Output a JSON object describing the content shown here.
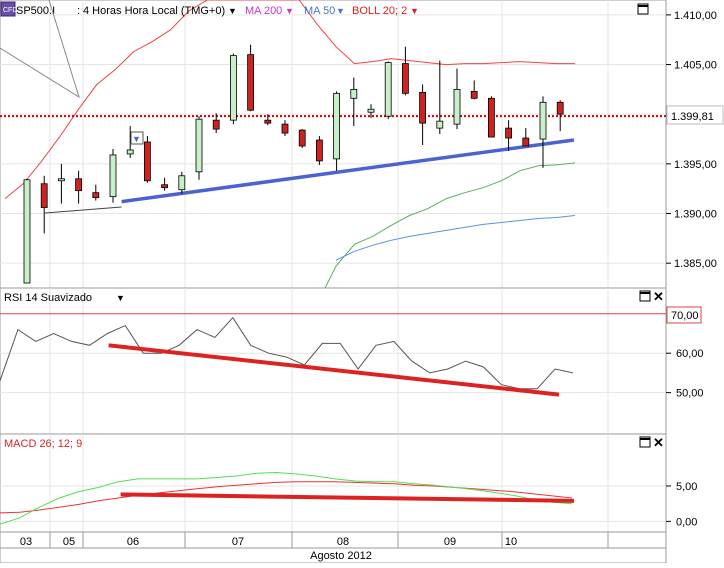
{
  "main_panel": {
    "symbol": "SP500.I",
    "timeframe": "4 Horas Hora Local (TMG+0)",
    "ma200_label": "MA 200",
    "ma50_label": "MA 50",
    "boll_label": "BOLL 20; 2",
    "last_price_label": "1.399,81",
    "y_ticks": [
      "1.410,00",
      "1.405,00",
      "1.400,00",
      "1.395,00",
      "1.390,00",
      "1.385,00"
    ]
  },
  "rsi_panel": {
    "title": "RSI 14 Suavizado",
    "level_label": "70,00",
    "y_ticks": [
      "60,00",
      "50,00"
    ]
  },
  "macd_panel": {
    "title": "MACD 26; 12; 9",
    "y_ticks": [
      "5,00",
      "0,00"
    ]
  },
  "x_axis": {
    "days": [
      "03",
      "05",
      "06",
      "07",
      "08",
      "09",
      "10"
    ],
    "month_label": "Agosto 2012"
  },
  "colors": {
    "bull": "#c8f0c8",
    "bear": "#cc2222",
    "boll": "#ee4444",
    "ma50": "#5b8fe8",
    "ma200": "#5cae5c",
    "trendline_blue": "#4a63d0",
    "trendline_red": "#dd2222",
    "rsi_line": "#555555",
    "macd_line": "#ee3333",
    "signal_line": "#55dd55"
  },
  "chart_data": [
    {
      "type": "candlestick",
      "title": "SP500.I 4 Horas Hora Local (TMG+0)",
      "ylim": [
        1382.5,
        1411.5
      ],
      "candles": [
        {
          "open": 1383.0,
          "high": 1393.5,
          "low": 1383.0,
          "close": 1393.4
        },
        {
          "open": 1393.0,
          "high": 1393.8,
          "low": 1388.0,
          "close": 1390.6
        },
        {
          "open": 1393.3,
          "high": 1395.0,
          "low": 1391.0,
          "close": 1393.5
        },
        {
          "open": 1393.5,
          "high": 1394.3,
          "low": 1391.0,
          "close": 1392.3
        },
        {
          "open": 1392.1,
          "high": 1392.9,
          "low": 1391.3,
          "close": 1391.6
        },
        {
          "open": 1391.7,
          "high": 1396.5,
          "low": 1391.1,
          "close": 1395.9
        },
        {
          "open": 1396.0,
          "high": 1398.8,
          "low": 1395.6,
          "close": 1396.4
        },
        {
          "open": 1397.2,
          "high": 1397.8,
          "low": 1393.1,
          "close": 1393.3
        },
        {
          "open": 1392.9,
          "high": 1393.6,
          "low": 1392.3,
          "close": 1392.6
        },
        {
          "open": 1392.4,
          "high": 1394.2,
          "low": 1392.0,
          "close": 1393.8
        },
        {
          "open": 1394.2,
          "high": 1399.8,
          "low": 1393.4,
          "close": 1399.5
        },
        {
          "open": 1399.4,
          "high": 1400.1,
          "low": 1398.1,
          "close": 1398.5
        },
        {
          "open": 1399.4,
          "high": 1406.1,
          "low": 1399.0,
          "close": 1405.9
        },
        {
          "open": 1406.0,
          "high": 1407.0,
          "low": 1400.3,
          "close": 1400.4
        },
        {
          "open": 1399.4,
          "high": 1400.0,
          "low": 1398.9,
          "close": 1399.1
        },
        {
          "open": 1399.0,
          "high": 1399.4,
          "low": 1397.8,
          "close": 1398.1
        },
        {
          "open": 1398.4,
          "high": 1398.5,
          "low": 1396.6,
          "close": 1396.8
        },
        {
          "open": 1397.4,
          "high": 1397.8,
          "low": 1394.9,
          "close": 1395.3
        },
        {
          "open": 1395.5,
          "high": 1402.3,
          "low": 1394.3,
          "close": 1402.1
        },
        {
          "open": 1401.6,
          "high": 1403.7,
          "low": 1398.8,
          "close": 1402.5
        },
        {
          "open": 1400.2,
          "high": 1401.0,
          "low": 1399.6,
          "close": 1400.5
        },
        {
          "open": 1399.8,
          "high": 1405.3,
          "low": 1399.5,
          "close": 1405.2
        },
        {
          "open": 1405.1,
          "high": 1406.8,
          "low": 1401.9,
          "close": 1402.1
        },
        {
          "open": 1402.2,
          "high": 1403.0,
          "low": 1396.9,
          "close": 1399.1
        },
        {
          "open": 1398.6,
          "high": 1405.4,
          "low": 1398.0,
          "close": 1399.3
        },
        {
          "open": 1399.0,
          "high": 1404.6,
          "low": 1398.5,
          "close": 1402.5
        },
        {
          "open": 1402.3,
          "high": 1403.4,
          "low": 1401.5,
          "close": 1401.6
        },
        {
          "open": 1401.6,
          "high": 1401.8,
          "low": 1397.7,
          "close": 1397.7
        },
        {
          "open": 1398.6,
          "high": 1399.4,
          "low": 1396.3,
          "close": 1397.6
        },
        {
          "open": 1397.6,
          "high": 1398.6,
          "low": 1396.8,
          "close": 1396.8
        },
        {
          "open": 1397.5,
          "high": 1401.8,
          "low": 1394.6,
          "close": 1401.2
        },
        {
          "open": 1401.2,
          "high": 1401.4,
          "low": 1398.3,
          "close": 1400.0
        }
      ],
      "boll_upper": [
        1391.5,
        1393.0,
        1395.3,
        1397.8,
        1400.5,
        1403.0,
        1404.5,
        1406.3,
        1407.3,
        1408.5,
        1410.4,
        1411.5,
        1411.5,
        1411.5,
        1411.5,
        1411.5,
        1411.5,
        1409.0,
        1406.8,
        1405.1,
        1405.3,
        1405.6,
        1405.4,
        1405.2,
        1405.0,
        1405.1,
        1405.1,
        1405.2,
        1405.3,
        1405.2,
        1405.1,
        1405.1
      ],
      "boll_lower": [
        null,
        null,
        null,
        null,
        null,
        null,
        null,
        null,
        null,
        null,
        null,
        null,
        null,
        null,
        null,
        null,
        null,
        1381.0,
        1384.7,
        1386.9,
        1387.7,
        1388.8,
        1389.8,
        1390.5,
        1391.5,
        1392.1,
        1392.6,
        1393.3,
        1394.3,
        1394.8,
        1394.9,
        1395.1
      ],
      "ma50": [
        null,
        null,
        null,
        null,
        null,
        null,
        null,
        null,
        null,
        null,
        null,
        null,
        null,
        null,
        null,
        null,
        null,
        null,
        1385.3,
        1386.2,
        1386.8,
        1387.3,
        1387.7,
        1388.0,
        1388.3,
        1388.6,
        1388.9,
        1389.1,
        1389.3,
        1389.5,
        1389.6,
        1389.8
      ],
      "last_price": 1399.81,
      "trendline": [
        [
          5.5,
          1391.2
        ],
        [
          31.8,
          1397.4
        ]
      ]
    },
    {
      "type": "line",
      "title": "RSI 14 Suavizado",
      "ylim": [
        39.5,
        73.5
      ],
      "level": 70,
      "values": [
        53.0,
        66.0,
        63.0,
        65.0,
        63.0,
        62.0,
        65.0,
        67.0,
        60.0,
        60.0,
        62.0,
        66.0,
        64.0,
        69.0,
        62.0,
        60.0,
        59.0,
        57.0,
        62.5,
        62.5,
        56.0,
        62.0,
        63.0,
        58.0,
        55.0,
        56.0,
        58.0,
        56.5,
        52.0,
        51.0,
        51.0,
        56.0,
        55.0
      ],
      "trendline": [
        [
          5.5,
          62.0
        ],
        [
          31.8,
          49.5
        ]
      ]
    },
    {
      "type": "line",
      "title": "MACD 26; 12; 9",
      "ylim": [
        -1.5,
        10.5
      ],
      "series": [
        {
          "values": [
            1.2,
            1.3,
            1.6,
            2.0,
            2.4,
            2.9,
            3.3,
            3.7,
            4.0,
            4.3,
            4.6,
            4.9,
            5.1,
            5.3,
            5.5,
            5.6,
            5.6,
            5.6,
            5.5,
            5.4,
            5.3,
            5.1,
            5.0,
            4.8,
            4.6,
            4.4,
            4.2,
            3.9,
            3.6,
            3.3
          ]
        },
        {
          "values": [
            -0.4,
            0.5,
            2.0,
            3.3,
            4.2,
            4.8,
            5.6,
            6.0,
            6.0,
            6.0,
            6.0,
            6.2,
            6.4,
            6.8,
            6.9,
            6.7,
            6.4,
            6.0,
            5.7,
            5.6,
            5.6,
            5.3,
            5.1,
            4.8,
            4.5,
            4.1,
            3.7,
            3.1,
            2.7,
            2.5
          ]
        }
      ],
      "trendline": [
        [
          5.5,
          3.8
        ],
        [
          31.8,
          2.9
        ]
      ]
    }
  ]
}
